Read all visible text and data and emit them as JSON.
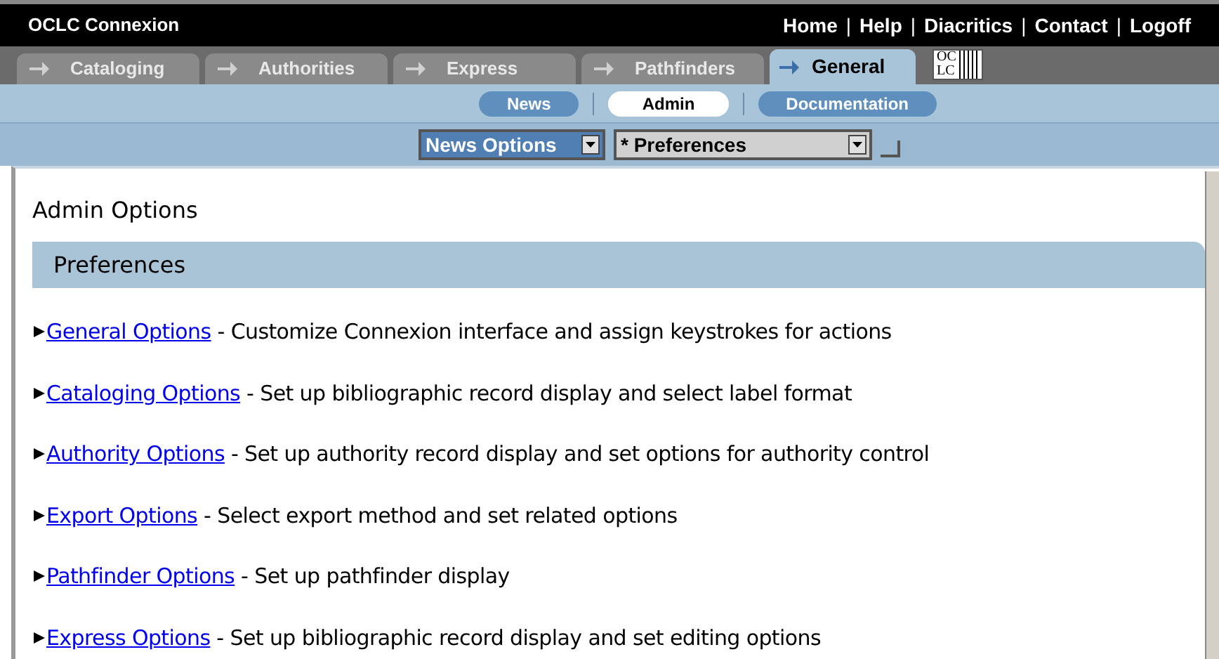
{
  "header": {
    "title": "OCLC Connexion",
    "links": [
      "Home",
      "Help",
      "Diacritics",
      "Contact",
      "Logoff"
    ],
    "separator": "|"
  },
  "tabs": [
    {
      "label": "Cataloging",
      "selected": false
    },
    {
      "label": "Authorities",
      "selected": false
    },
    {
      "label": "Express",
      "selected": false
    },
    {
      "label": "Pathfinders",
      "selected": false
    },
    {
      "label": "General",
      "selected": true
    }
  ],
  "logo": {
    "top": "OC",
    "bottom": "LC"
  },
  "subnav": [
    {
      "label": "News",
      "selected": false
    },
    {
      "label": "Admin",
      "selected": true
    },
    {
      "label": "Documentation",
      "selected": false
    }
  ],
  "selects": [
    {
      "value": "News Options",
      "kind": "highlighted"
    },
    {
      "value": "* Preferences",
      "kind": "plain"
    }
  ],
  "page_title": "Admin Options",
  "section": "Preferences",
  "options": [
    {
      "link": "General Options",
      "description": " - Customize Connexion interface and assign keystrokes for actions"
    },
    {
      "link": "Cataloging Options",
      "description": " - Set up bibliographic record display and select label format"
    },
    {
      "link": "Authority Options",
      "description": " - Set up authority record display and set options for authority control"
    },
    {
      "link": "Export Options",
      "description": " - Select export method and set related options"
    },
    {
      "link": "Pathfinder Options",
      "description": " - Set up pathfinder display"
    },
    {
      "link": "Express Options",
      "description": " - Set up bibliographic record display and set editing options"
    }
  ]
}
